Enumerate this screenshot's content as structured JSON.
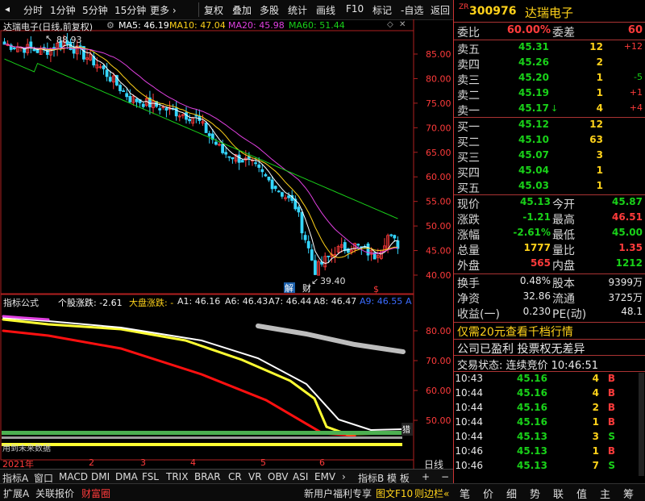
{
  "toolbar": {
    "items": [
      "分时",
      "1分钟",
      "5分钟",
      "15分钟",
      "更多 ›",
      "复权",
      "叠加",
      "多股",
      "统计",
      "画线",
      "F10",
      "标记",
      "-自选",
      "返回"
    ]
  },
  "main_chart": {
    "title": "达瑞电子(日线,前复权)",
    "ma": [
      {
        "label": "MA5: 46.19",
        "color": "#ffffff"
      },
      {
        "label": "MA10: 47.04",
        "color": "#ffd21a"
      },
      {
        "label": "MA20: 45.98",
        "color": "#e040e0"
      },
      {
        "label": "MA60: 51.44",
        "color": "#19d119"
      }
    ],
    "high_label": "88.93",
    "low_label": "39.40",
    "badge_jie": "解",
    "badge_cai": "财",
    "badge_s": "$",
    "yticks": [
      "85.00",
      "80.00",
      "75.00",
      "70.00",
      "65.00",
      "60.00",
      "55.00",
      "50.00",
      "45.00",
      "40.00"
    ]
  },
  "indicator": {
    "title": "指标公式",
    "items": [
      {
        "label": "个股涨跌: -2.61",
        "color": "#ffffff"
      },
      {
        "label": "大盘涨跌: -",
        "color": "#ffd21a"
      },
      {
        "label": "A1: 46.16",
        "color": "#e8e8e8"
      },
      {
        "label": "A6: 46.43",
        "color": "#e8e8e8"
      },
      {
        "label": "A7: 46.44",
        "color": "#e8e8e8"
      },
      {
        "label": "A8: 46.47",
        "color": "#e8e8e8"
      },
      {
        "label": "A9: 46.55",
        "color": "#3b6cff"
      },
      {
        "label": "A",
        "color": "#3b6cff"
      }
    ],
    "yticks": [
      "80.00",
      "70.00",
      "60.00",
      "50.00"
    ],
    "note": "用到未来数据",
    "tag": "猎"
  },
  "xaxis": {
    "labels": [
      "2021年",
      "2",
      "3",
      "4",
      "5",
      "6"
    ],
    "right_label": "日线"
  },
  "tabs": [
    "指标A",
    "窗口",
    "MACD",
    "DMI",
    "DMA",
    "FSL",
    "TRIX",
    "BRAR",
    "CR",
    "VR",
    "OBV",
    "ASI",
    "EMV",
    "›",
    "指标B",
    "模 板",
    "+",
    "−"
  ],
  "statusbar": {
    "left": [
      "扩展A",
      "关联报价",
      "财富圈"
    ],
    "right": [
      "新用户福利专享",
      "图文F10",
      "则边栏«"
    ]
  },
  "quote": {
    "code": "300976",
    "name": "达瑞电子",
    "weibi_label": "委比",
    "weibi": "60.00%",
    "weicha_label": "委差",
    "weicha": "60",
    "sell": [
      {
        "label": "卖五",
        "price": "45.31",
        "vol": "12",
        "chg": "+12"
      },
      {
        "label": "卖四",
        "price": "45.26",
        "vol": "2",
        "chg": ""
      },
      {
        "label": "卖三",
        "price": "45.20",
        "vol": "1",
        "chg": "-5"
      },
      {
        "label": "卖二",
        "price": "45.19",
        "vol": "1",
        "chg": "+1"
      },
      {
        "label": "卖一",
        "price": "45.17",
        "vol": "4",
        "chg": "+4"
      }
    ],
    "buy": [
      {
        "label": "买一",
        "price": "45.12",
        "vol": "12"
      },
      {
        "label": "买二",
        "price": "45.10",
        "vol": "63"
      },
      {
        "label": "买三",
        "price": "45.07",
        "vol": "3"
      },
      {
        "label": "买四",
        "price": "45.04",
        "vol": "1"
      },
      {
        "label": "买五",
        "price": "45.03",
        "vol": "1"
      }
    ],
    "stats": [
      {
        "l1": "现价",
        "v1": "45.13",
        "l2": "今开",
        "v2": "45.87"
      },
      {
        "l1": "涨跌",
        "v1": "-1.21",
        "l2": "最高",
        "v2": "46.51"
      },
      {
        "l1": "涨幅",
        "v1": "-2.61%",
        "l2": "最低",
        "v2": "45.00"
      },
      {
        "l1": "总量",
        "v1": "1777",
        "l2": "量比",
        "v2": "1.35"
      },
      {
        "l1": "外盘",
        "v1": "565",
        "l2": "内盘",
        "v2": "1212"
      }
    ],
    "stats2": [
      {
        "l1": "换手",
        "v1": "0.48%",
        "l2": "股本",
        "v2": "9399万"
      },
      {
        "l1": "净资",
        "v1": "32.86",
        "l2": "流通",
        "v2": "3725万"
      },
      {
        "l1": "收益(一)",
        "v1": "0.230",
        "l2": "PE(动)",
        "v2": "48.1"
      }
    ],
    "promo1": "仅需20元查看千档行情",
    "promo2": "公司已盈利 投票权无差异",
    "trade_state": "交易状态: 连续竞价 10:46:51",
    "ticks": [
      {
        "time": "10:43",
        "price": "45.16",
        "vol": "4",
        "side": "B"
      },
      {
        "time": "10:44",
        "price": "45.16",
        "vol": "4",
        "side": "B"
      },
      {
        "time": "10:44",
        "price": "45.16",
        "vol": "2",
        "side": "B"
      },
      {
        "time": "10:44",
        "price": "45.16",
        "vol": "1",
        "side": "B"
      },
      {
        "time": "10:44",
        "price": "45.13",
        "vol": "3",
        "side": "S"
      },
      {
        "time": "10:46",
        "price": "45.13",
        "vol": "1",
        "side": "B"
      },
      {
        "time": "10:46",
        "price": "45.13",
        "vol": "7",
        "side": "S"
      }
    ],
    "bottom_icons": [
      "笔",
      "价",
      "细",
      "势",
      "联",
      "值",
      "主",
      "筹"
    ]
  },
  "colors": {
    "up": "#ff3b3b",
    "down": "#19d119",
    "ma5": "#ffffff",
    "ma10": "#ffd21a",
    "ma20": "#e040e0",
    "ma60": "#19d119"
  }
}
